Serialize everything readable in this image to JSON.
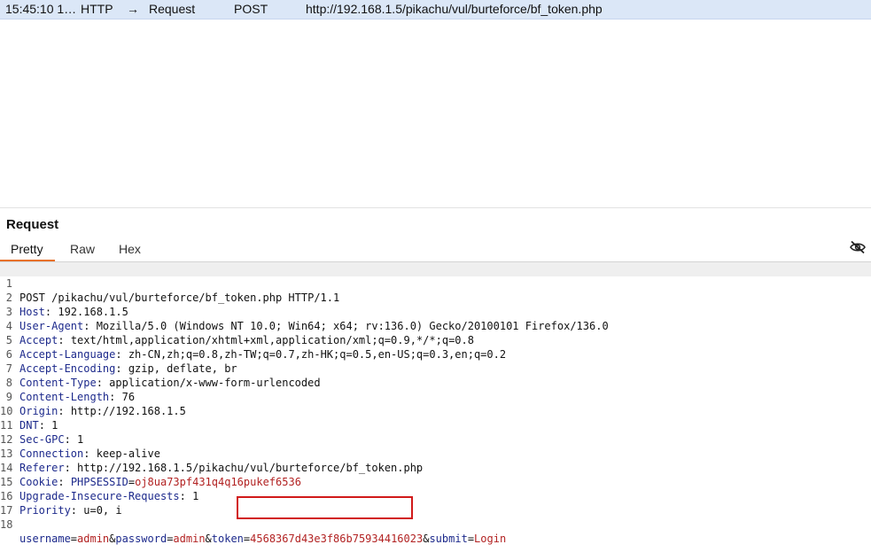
{
  "history": {
    "time": "15:45:10 1…",
    "tool": "HTTP",
    "direction": "Request",
    "method": "POST",
    "url": "http://192.168.1.5/pikachu/vul/burteforce/bf_token.php"
  },
  "panel": {
    "title": "Request",
    "tabs": [
      "Pretty",
      "Raw",
      "Hex"
    ],
    "active_tab": "Pretty"
  },
  "request": {
    "line_numbers": [
      "1",
      "2",
      "3",
      "4",
      "5",
      "6",
      "7",
      "8",
      "9",
      "10",
      "11",
      "12",
      "13",
      "14",
      "15",
      "16",
      "17",
      "18"
    ],
    "request_line": "POST /pikachu/vul/burteforce/bf_token.php HTTP/1.1",
    "headers": [
      {
        "name": "Host",
        "value": "192.168.1.5"
      },
      {
        "name": "User-Agent",
        "value": "Mozilla/5.0 (Windows NT 10.0; Win64; x64; rv:136.0) Gecko/20100101 Firefox/136.0"
      },
      {
        "name": "Accept",
        "value": "text/html,application/xhtml+xml,application/xml;q=0.9,*/*;q=0.8"
      },
      {
        "name": "Accept-Language",
        "value": "zh-CN,zh;q=0.8,zh-TW;q=0.7,zh-HK;q=0.5,en-US;q=0.3,en;q=0.2"
      },
      {
        "name": "Accept-Encoding",
        "value": "gzip, deflate, br"
      },
      {
        "name": "Content-Type",
        "value": "application/x-www-form-urlencoded"
      },
      {
        "name": "Content-Length",
        "value": "76"
      },
      {
        "name": "Origin",
        "value": "http://192.168.1.5"
      },
      {
        "name": "DNT",
        "value": "1"
      },
      {
        "name": "Sec-GPC",
        "value": "1"
      },
      {
        "name": "Connection",
        "value": "keep-alive"
      },
      {
        "name": "Referer",
        "value": "http://192.168.1.5/pikachu/vul/burteforce/bf_token.php"
      }
    ],
    "cookie": {
      "name": "Cookie",
      "cookie_name": "PHPSESSID",
      "cookie_value": "oj8ua73pf431q4q16pukef6536"
    },
    "headers_after_cookie": [
      {
        "name": "Upgrade-Insecure-Requests",
        "value": "1"
      },
      {
        "name": "Priority",
        "value": "u=0, i"
      }
    ],
    "body_params": [
      {
        "name": "username",
        "value": "admin"
      },
      {
        "name": "password",
        "value": "admin"
      },
      {
        "name": "token",
        "value": "4568367d43e3f86b75934416023"
      },
      {
        "name": "submit",
        "value": "Login"
      }
    ]
  },
  "colors": {
    "header_name": "#1d2a8c",
    "param_value": "#b22222",
    "highlight_box": "#d11a1a",
    "active_tab_underline": "#e8712b",
    "selected_row": "#dbe7f7"
  },
  "icons": {
    "arrow": "arrow-right-icon",
    "eye": "eye-slash-icon"
  }
}
